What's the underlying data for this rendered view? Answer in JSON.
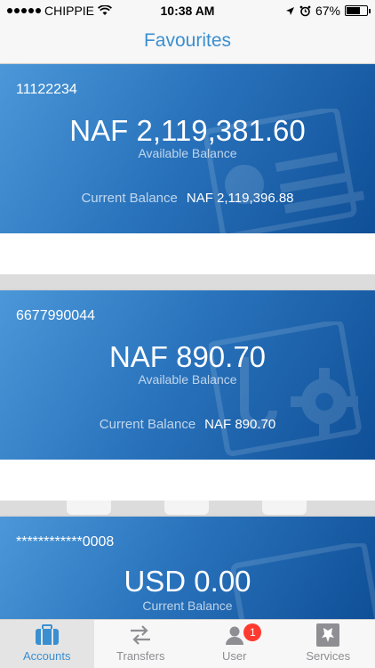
{
  "status_bar": {
    "carrier": "CHIPPIE",
    "time": "10:38 AM",
    "battery": "67%",
    "battery_level": 0.67
  },
  "nav": {
    "title": "Favourites"
  },
  "accounts": [
    {
      "number": "11122234",
      "amount": "NAF 2,119,381.60",
      "amount_label": "Available Balance",
      "current_label": "Current Balance",
      "current_amount": "NAF 2,119,396.88"
    },
    {
      "number": "6677990044",
      "amount": "NAF 890.70",
      "amount_label": "Available Balance",
      "current_label": "Current Balance",
      "current_amount": "NAF 890.70"
    },
    {
      "number": "************0008",
      "amount": "USD 0.00",
      "amount_label": "Current Balance"
    }
  ],
  "tabs": [
    {
      "label": "Accounts",
      "icon": "briefcase-icon",
      "active": true
    },
    {
      "label": "Transfers",
      "icon": "transfer-arrows-icon"
    },
    {
      "label": "User",
      "icon": "user-icon",
      "badge": "1"
    },
    {
      "label": "Services",
      "icon": "services-logo-icon"
    }
  ],
  "colors": {
    "accent": "#3a8fd1",
    "card_light": "#4b97d8",
    "card_dark": "#0f4f97",
    "badge": "#ff3b30"
  }
}
